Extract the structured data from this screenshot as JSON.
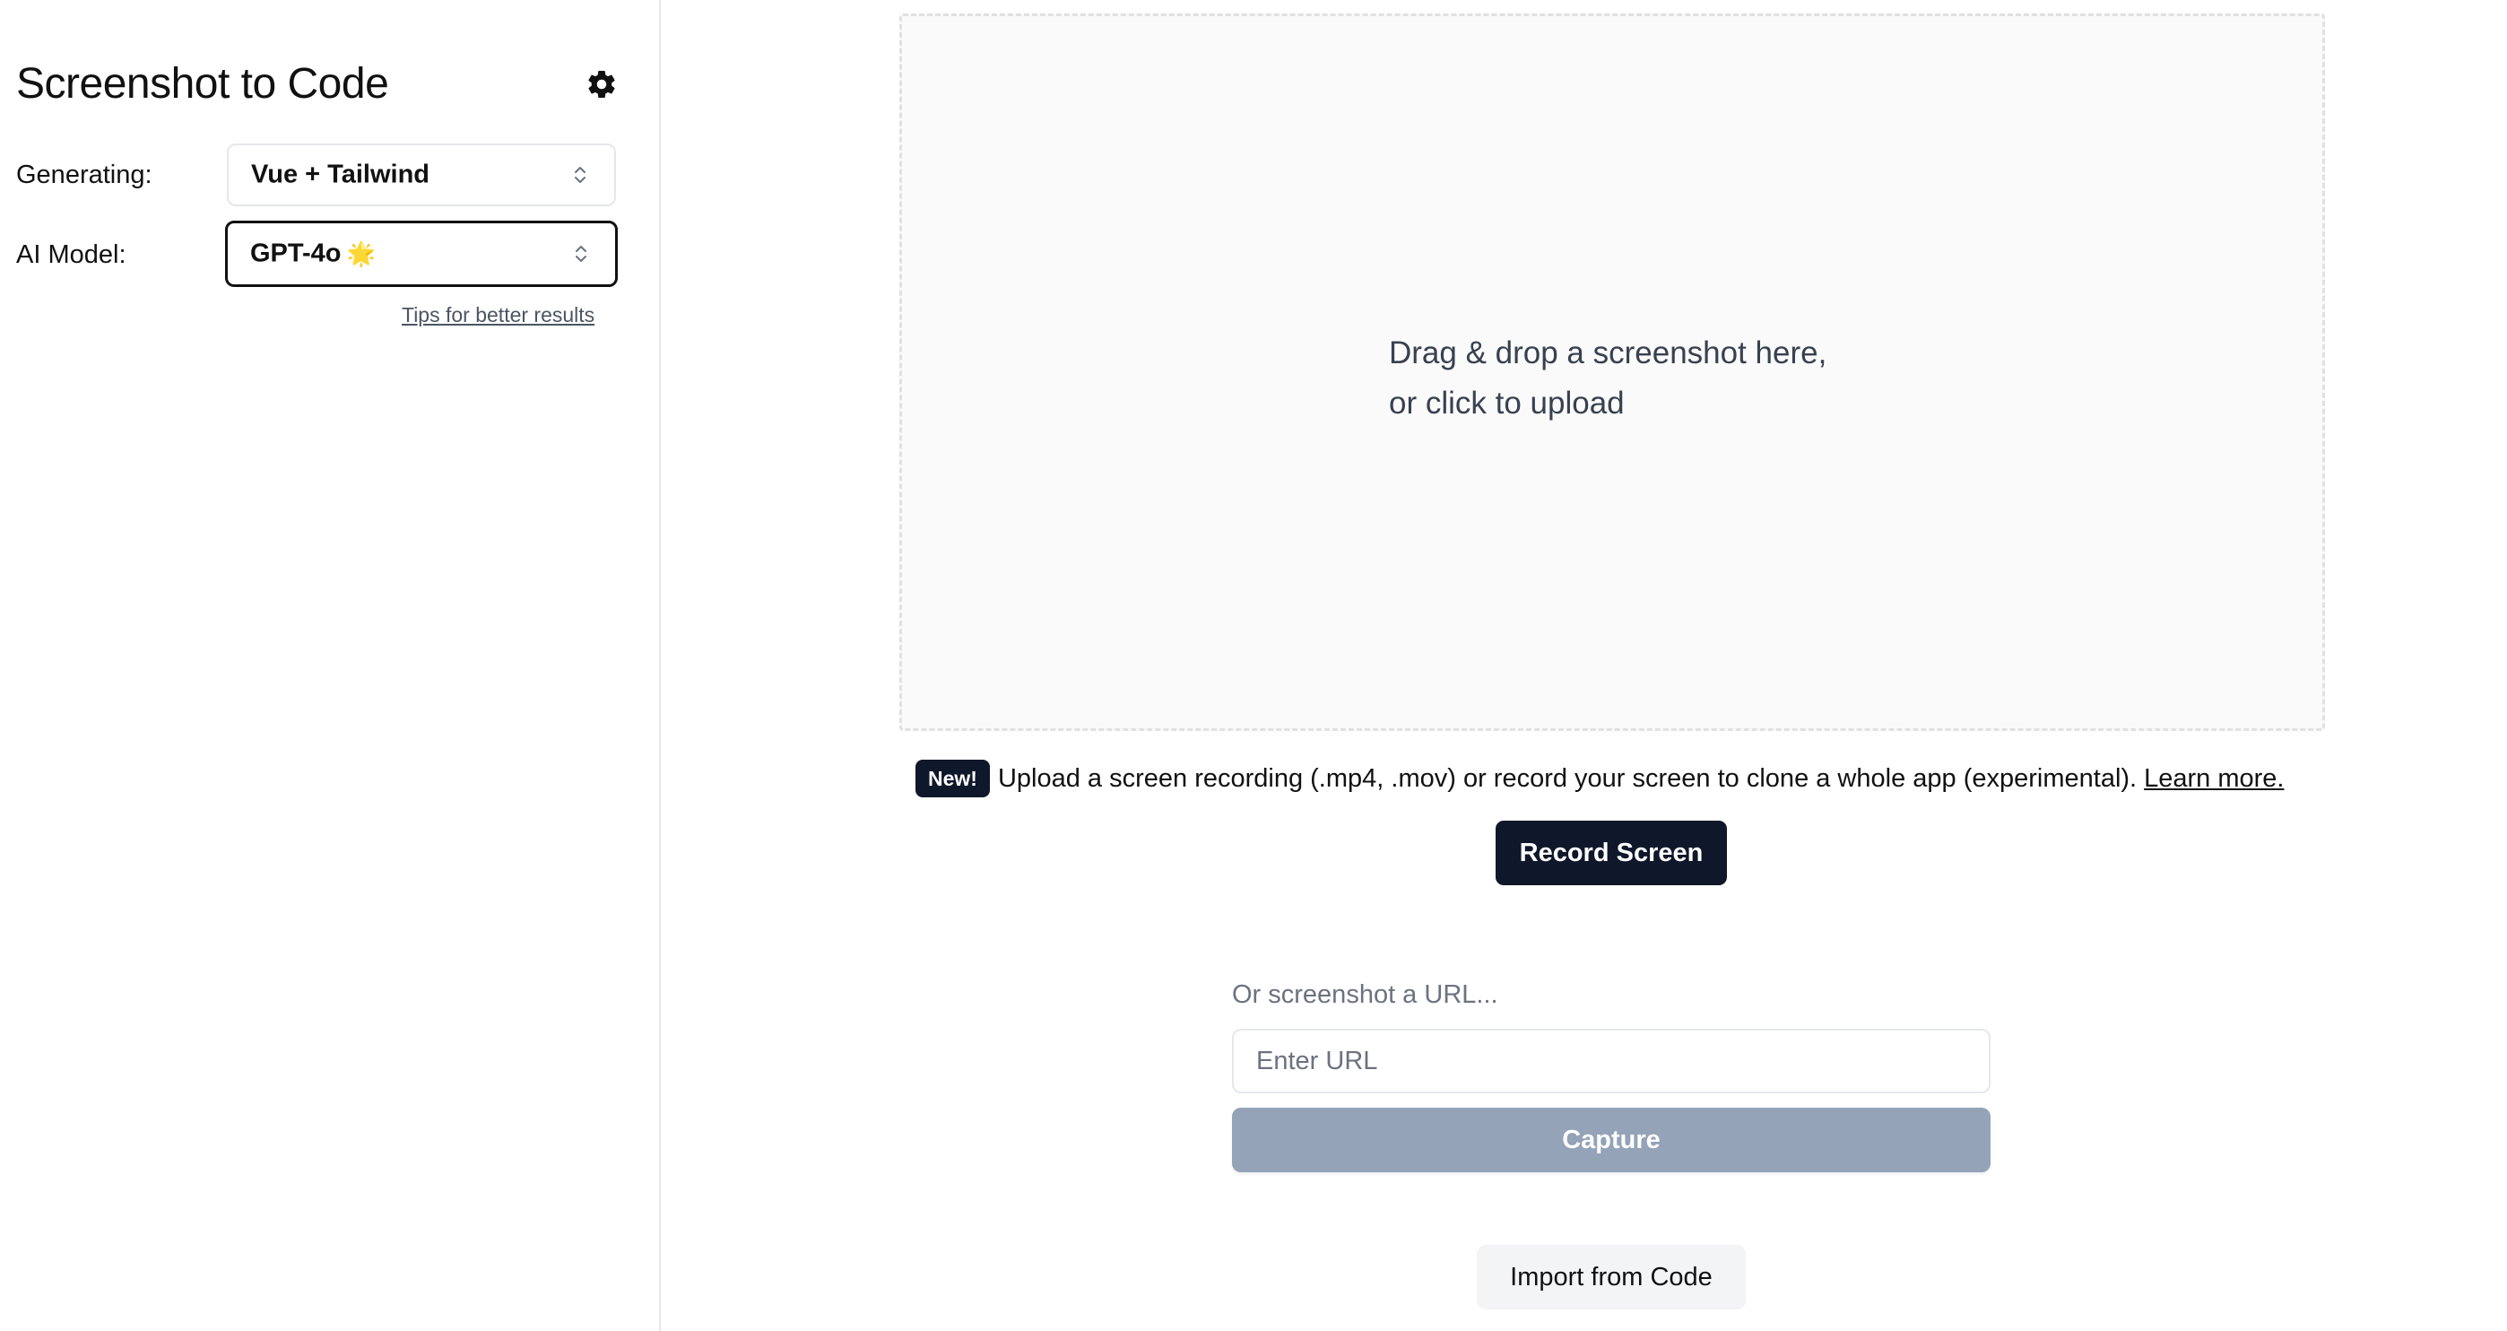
{
  "sidebar": {
    "title": "Screenshot to Code",
    "settings_icon": "gear-icon",
    "generating_label": "Generating:",
    "generating_value": "Vue + Tailwind",
    "model_label": "AI Model:",
    "model_value": "GPT-4o",
    "model_emoji": "🌟",
    "tips_link": "Tips for better results"
  },
  "main": {
    "dropzone_line1": "Drag & drop a screenshot here,",
    "dropzone_line2": "or click to upload",
    "new_badge": "New!",
    "recording_text": "Upload a screen recording (.mp4, .mov) or record your screen to clone a whole app (experimental).",
    "learn_more": "Learn more.",
    "record_button": "Record Screen",
    "url_label": "Or screenshot a URL...",
    "url_placeholder": "Enter URL",
    "capture_button": "Capture",
    "import_button": "Import from Code"
  },
  "colors": {
    "primary_dark": "#0f172a",
    "capture_disabled": "#94a3b8",
    "dropzone_bg": "#fafafa",
    "border": "#e5e7eb"
  }
}
